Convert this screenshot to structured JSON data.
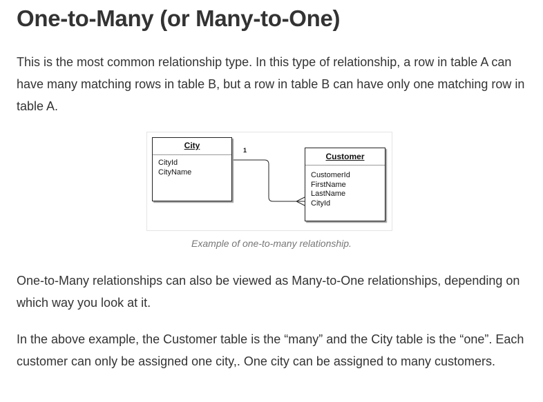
{
  "heading": "One-to-Many (or Many-to-One)",
  "paragraphs": {
    "intro": "This is the most common relationship type. In this type of relationship, a row in table A can have many matching rows in table B, but a row in table B can have only one matching row in table A.",
    "many_to_one": "One-to-Many relationships can also be viewed as Many-to-One relationships, depending on which way you look at it.",
    "example": "In the above example, the Customer table is the “many” and the City table is the “one”. Each customer can only be assigned one city,. One city can be assigned to many customers."
  },
  "figure": {
    "caption": "Example of one-to-many relationship.",
    "city_table": {
      "title": "City",
      "fields": [
        "CityId",
        "CityName"
      ]
    },
    "customer_table": {
      "title": "Customer",
      "fields": [
        "CustomerId",
        "FirstName",
        "LastName",
        "CityId"
      ]
    },
    "relationship": {
      "one_label": "1",
      "many_symbol": "crows-foot"
    }
  },
  "colors": {
    "text": "#333333",
    "caption": "#777777",
    "diagram_line": "#222222"
  }
}
